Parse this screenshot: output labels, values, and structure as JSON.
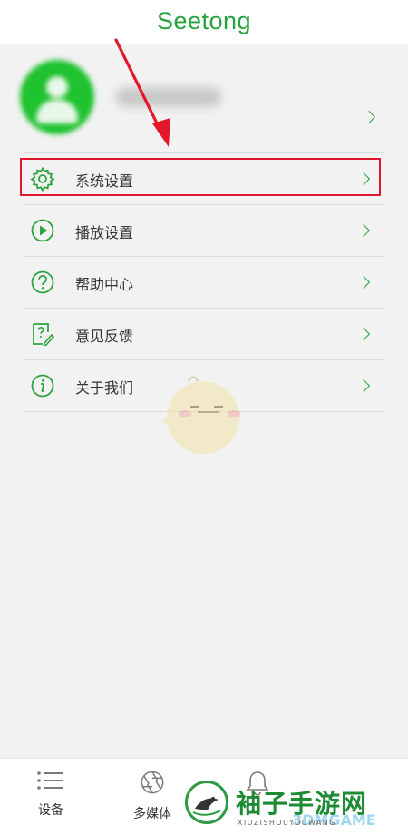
{
  "header": {
    "title": "Seetong"
  },
  "menu": {
    "items": [
      {
        "label": "系统设置",
        "icon": "gear-icon"
      },
      {
        "label": "播放设置",
        "icon": "play-circle-icon"
      },
      {
        "label": "帮助中心",
        "icon": "help-icon"
      },
      {
        "label": "意见反馈",
        "icon": "feedback-icon"
      },
      {
        "label": "关于我们",
        "icon": "info-icon"
      }
    ]
  },
  "tabbar": {
    "items": [
      {
        "label": "设备",
        "icon": "list-icon"
      },
      {
        "label": "多媒体",
        "icon": "aperture-icon"
      },
      {
        "label": "",
        "icon": "bell-icon"
      }
    ]
  },
  "watermark": {
    "main": "袖子手游网",
    "sub": "XIUZISHOUYOUWANG",
    "brand": "3DMGAME"
  },
  "colors": {
    "accent": "#26a33f",
    "highlight": "#e0172a",
    "background": "#f2f2f2"
  }
}
